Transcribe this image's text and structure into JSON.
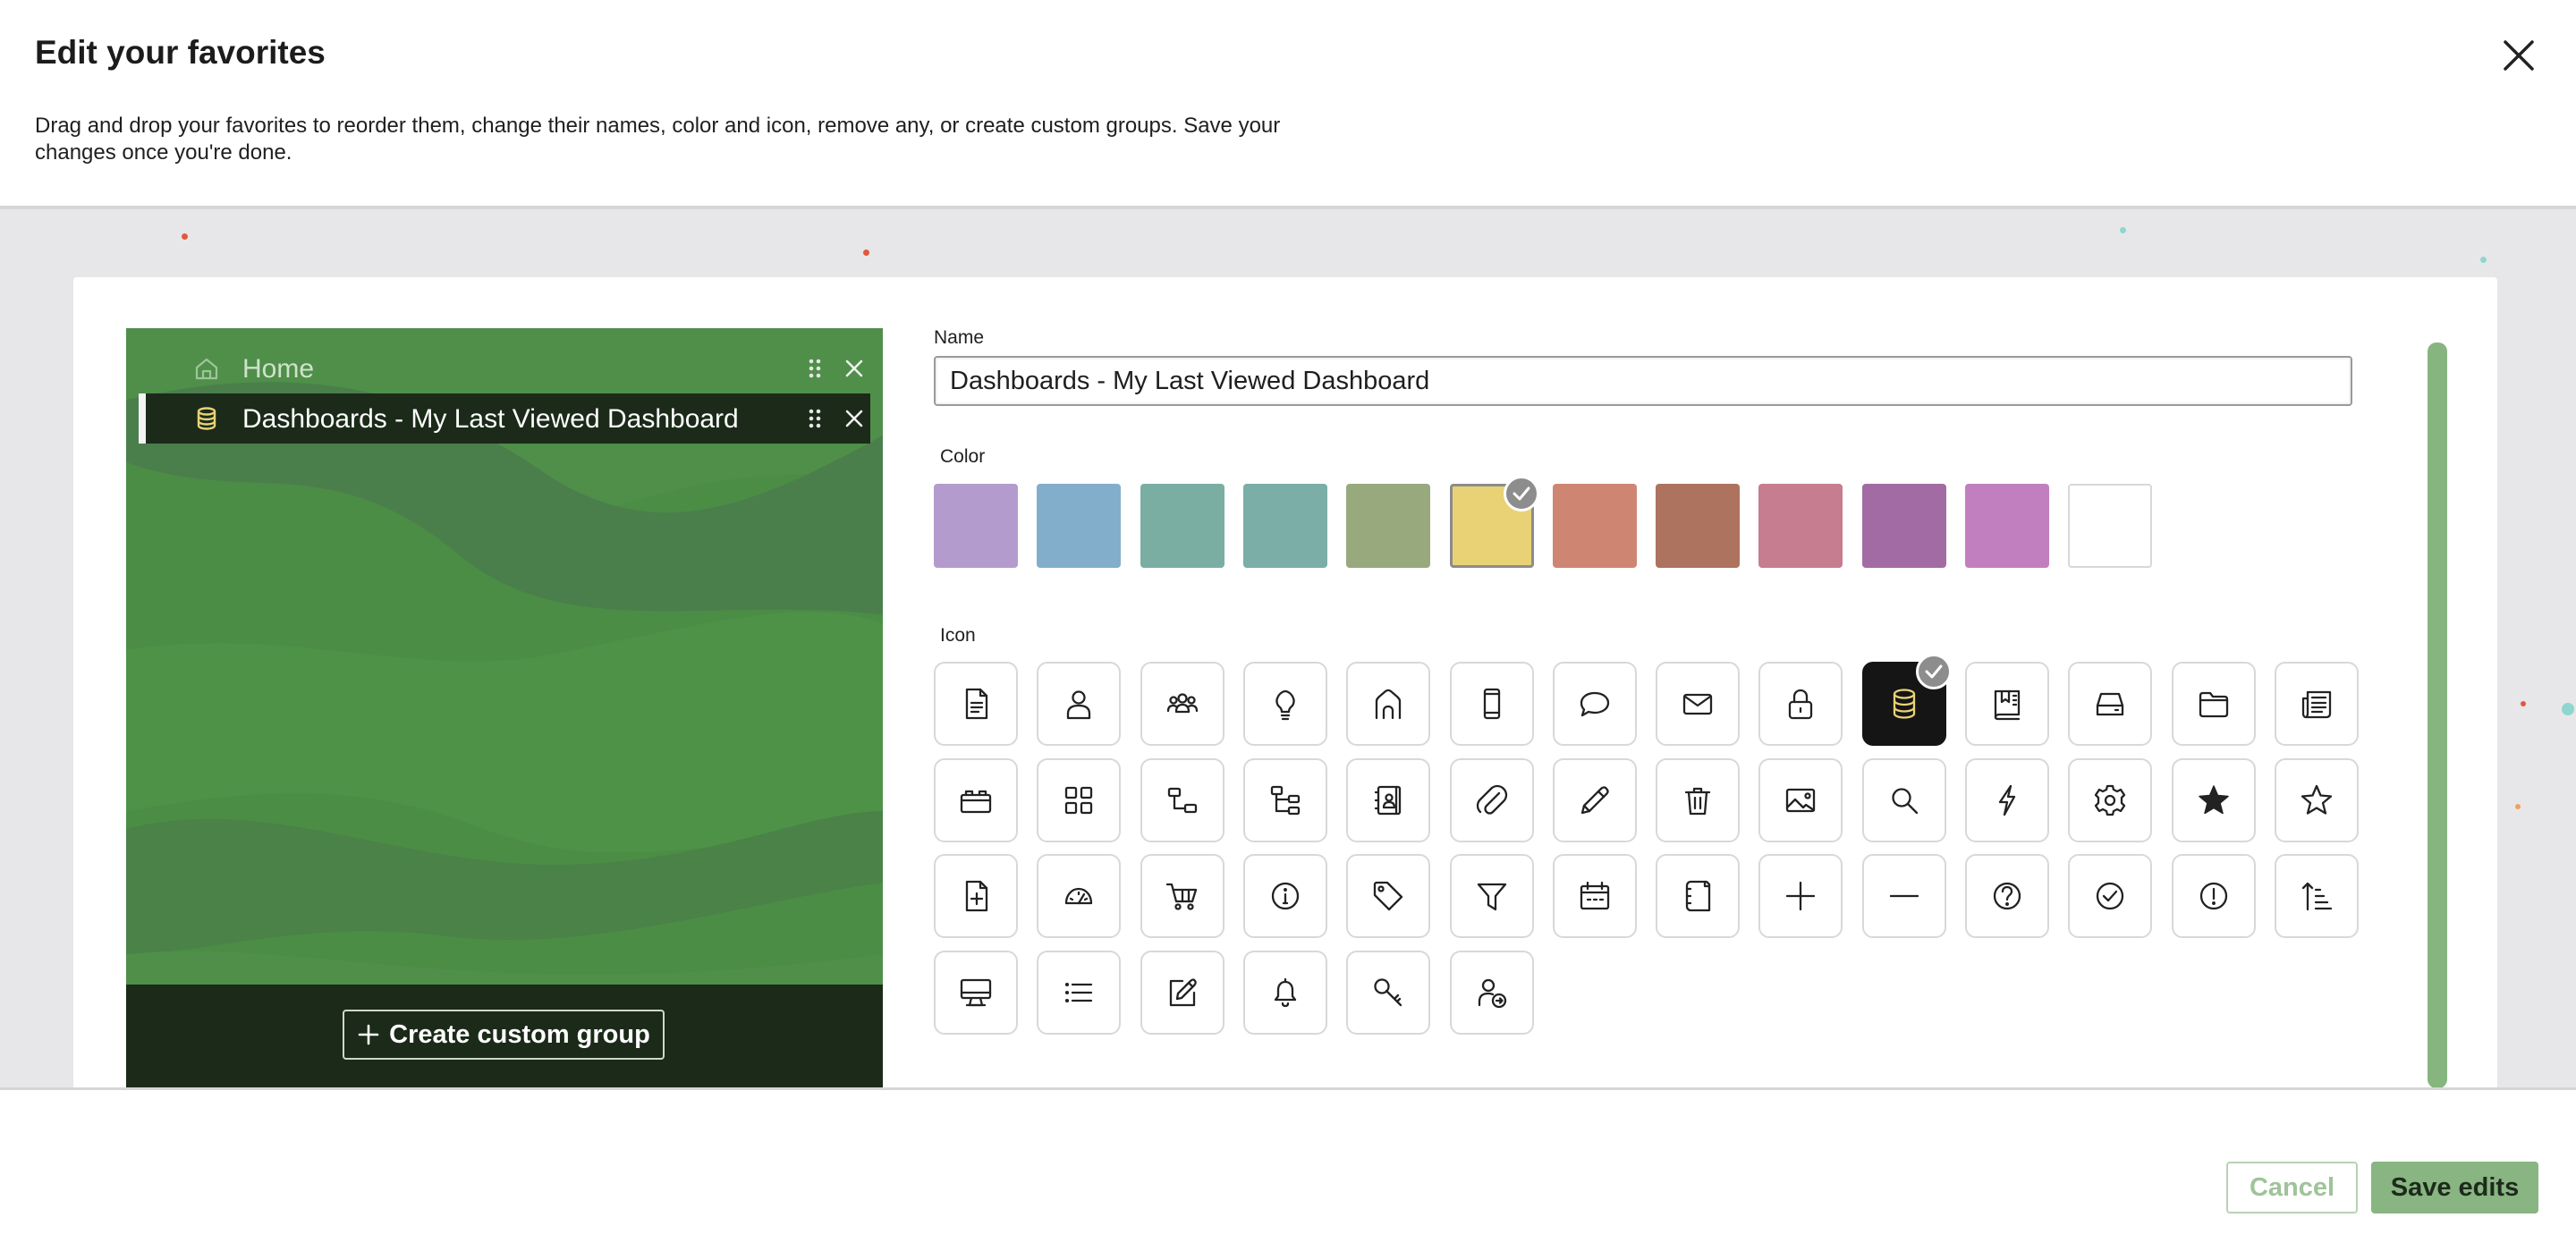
{
  "dialog": {
    "title": "Edit your favorites",
    "description": "Drag and drop your favorites to reorder them, change their names, color and icon, remove any, or create custom groups. Save your changes once you're done."
  },
  "favorites": [
    {
      "label": "Home",
      "icon": "home-icon",
      "active": false
    },
    {
      "label": "Dashboards - My Last Viewed Dashboard",
      "icon": "database-icon",
      "active": true
    }
  ],
  "create_group_label": "Create custom group",
  "form": {
    "name_label": "Name",
    "name_value": "Dashboards - My Last Viewed Dashboard",
    "color_label": "Color",
    "icon_label": "Icon"
  },
  "colors": [
    "#b39ccd",
    "#82aecb",
    "#7aaea3",
    "#7aaea6",
    "#98a97e",
    "#e9d276",
    "#ce8672",
    "#ad735f",
    "#c67d8f",
    "#a36ba3",
    "#c27fc0",
    "#ffffff"
  ],
  "selected_color": "#e9d276",
  "icons": [
    "document",
    "person",
    "group",
    "lightbulb",
    "home",
    "mobile",
    "chat",
    "mail",
    "lock",
    "database",
    "book",
    "inbox",
    "folder",
    "newspaper",
    "toolbox",
    "grid",
    "hierarchy",
    "tree",
    "contacts",
    "paperclip",
    "pencil",
    "trash",
    "image",
    "search",
    "lightning",
    "gear",
    "star-filled",
    "star-outline",
    "file-add",
    "gauge",
    "cart",
    "info",
    "tag",
    "filter",
    "calendar",
    "notebook",
    "plus",
    "minus",
    "help",
    "check-circle",
    "alert-circle",
    "sort",
    "desktop",
    "list",
    "edit",
    "bell",
    "key",
    "person-arrow"
  ],
  "selected_icon": "database",
  "footer": {
    "cancel_label": "Cancel",
    "save_label": "Save edits"
  }
}
